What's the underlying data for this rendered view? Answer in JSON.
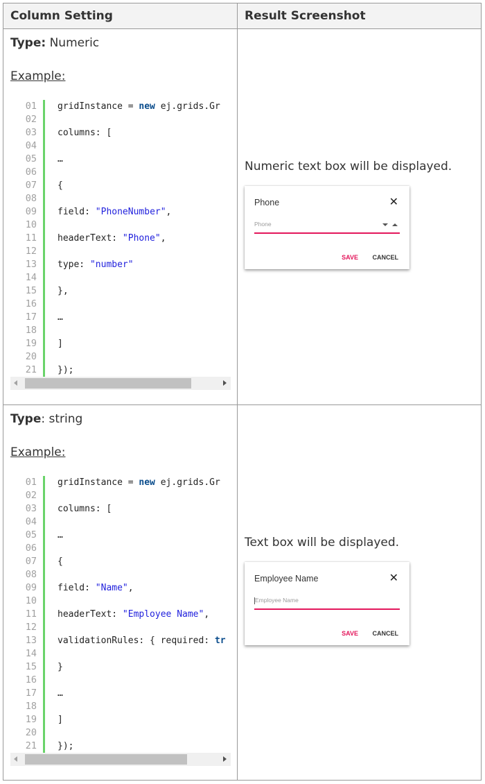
{
  "table": {
    "headers": [
      "Column Setting",
      "Result Screenshot"
    ],
    "rows": [
      {
        "type_label": "Type:",
        "type_value": " Numeric",
        "example_label": "Example:",
        "code": [
          {
            "n": "01",
            "parts": [
              [
                "t",
                "gridInstance = "
              ],
              [
                "k",
                "new"
              ],
              [
                "t",
                " ej.grids.Gr"
              ]
            ]
          },
          {
            "n": "02",
            "parts": []
          },
          {
            "n": "03",
            "parts": [
              [
                "t",
                "columns: ["
              ]
            ]
          },
          {
            "n": "04",
            "parts": []
          },
          {
            "n": "05",
            "parts": [
              [
                "t",
                "…"
              ]
            ]
          },
          {
            "n": "06",
            "parts": []
          },
          {
            "n": "07",
            "parts": [
              [
                "t",
                "{"
              ]
            ]
          },
          {
            "n": "08",
            "parts": []
          },
          {
            "n": "09",
            "parts": [
              [
                "t",
                "field: "
              ],
              [
                "s",
                "\"PhoneNumber\""
              ],
              [
                "t",
                ","
              ]
            ]
          },
          {
            "n": "10",
            "parts": []
          },
          {
            "n": "11",
            "parts": [
              [
                "t",
                "headerText: "
              ],
              [
                "s",
                "\"Phone\""
              ],
              [
                "t",
                ","
              ]
            ]
          },
          {
            "n": "12",
            "parts": []
          },
          {
            "n": "13",
            "parts": [
              [
                "t",
                "type: "
              ],
              [
                "s",
                "\"number\""
              ]
            ]
          },
          {
            "n": "14",
            "parts": []
          },
          {
            "n": "15",
            "parts": [
              [
                "t",
                "},"
              ]
            ]
          },
          {
            "n": "16",
            "parts": []
          },
          {
            "n": "17",
            "parts": [
              [
                "t",
                "…"
              ]
            ]
          },
          {
            "n": "18",
            "parts": []
          },
          {
            "n": "19",
            "parts": [
              [
                "t",
                "]"
              ]
            ]
          },
          {
            "n": "20",
            "parts": []
          },
          {
            "n": "21",
            "parts": [
              [
                "t",
                "});"
              ]
            ]
          }
        ],
        "scroll_thumb_fraction": 0.86,
        "result_text": "Numeric text box will be displayed.",
        "dialog": {
          "title": "Phone",
          "close_icon": "close-icon",
          "placeholder": "Phone",
          "has_spinner": true,
          "save_label": "SAVE",
          "cancel_label": "CANCEL"
        }
      },
      {
        "type_label": "Type",
        "type_value": ": string",
        "example_label": "Example:",
        "code": [
          {
            "n": "01",
            "parts": [
              [
                "t",
                "gridInstance = "
              ],
              [
                "k",
                "new"
              ],
              [
                "t",
                " ej.grids.Gr"
              ]
            ]
          },
          {
            "n": "02",
            "parts": []
          },
          {
            "n": "03",
            "parts": [
              [
                "t",
                "columns: ["
              ]
            ]
          },
          {
            "n": "04",
            "parts": []
          },
          {
            "n": "05",
            "parts": [
              [
                "t",
                "…"
              ]
            ]
          },
          {
            "n": "06",
            "parts": []
          },
          {
            "n": "07",
            "parts": [
              [
                "t",
                "{"
              ]
            ]
          },
          {
            "n": "08",
            "parts": []
          },
          {
            "n": "09",
            "parts": [
              [
                "t",
                "field: "
              ],
              [
                "s",
                "\"Name\""
              ],
              [
                "t",
                ","
              ]
            ]
          },
          {
            "n": "10",
            "parts": []
          },
          {
            "n": "11",
            "parts": [
              [
                "t",
                "headerText: "
              ],
              [
                "s",
                "\"Employee Name\""
              ],
              [
                "t",
                ","
              ]
            ]
          },
          {
            "n": "12",
            "parts": []
          },
          {
            "n": "13",
            "parts": [
              [
                "t",
                "validationRules: { required: "
              ],
              [
                "k",
                "tr"
              ]
            ]
          },
          {
            "n": "14",
            "parts": []
          },
          {
            "n": "15",
            "parts": [
              [
                "t",
                "}"
              ]
            ]
          },
          {
            "n": "16",
            "parts": []
          },
          {
            "n": "17",
            "parts": [
              [
                "t",
                "…"
              ]
            ]
          },
          {
            "n": "18",
            "parts": []
          },
          {
            "n": "19",
            "parts": [
              [
                "t",
                "]"
              ]
            ]
          },
          {
            "n": "20",
            "parts": []
          },
          {
            "n": "21",
            "parts": [
              [
                "t",
                "});"
              ]
            ]
          }
        ],
        "scroll_thumb_fraction": 0.84,
        "result_text": "Text box will be displayed.",
        "dialog": {
          "title": "Employee Name",
          "close_icon": "close-icon",
          "placeholder": "Employee Name",
          "has_spinner": false,
          "save_label": "SAVE",
          "cancel_label": "CANCEL"
        }
      }
    ]
  }
}
